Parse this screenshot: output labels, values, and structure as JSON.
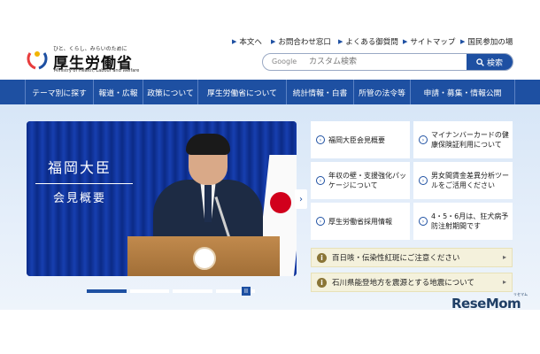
{
  "header": {
    "logo_tagline": "ひと、くらし、みらいのために",
    "logo_name": "厚生労働省",
    "logo_en": "Ministry of Health, Labour and Welfare",
    "util_links": [
      "本文へ",
      "お問合わせ窓口",
      "よくある御質問",
      "サイトマップ",
      "国民参加の場"
    ],
    "search": {
      "google_label": "Google",
      "placeholder": "カスタム検索",
      "button_label": "検索",
      "button_icon": "search-icon"
    }
  },
  "nav": {
    "items": [
      "テーマ別に探す",
      "報道・広報",
      "政策について",
      "厚生労働省について",
      "統計情報・白書",
      "所管の法令等",
      "申請・募集・情報公開"
    ]
  },
  "hero": {
    "caption_line1": "福岡大臣",
    "caption_line2": "会見概要",
    "slide_count": 6,
    "active_slide": 1,
    "pause_label": "II",
    "next_label": "›"
  },
  "cards": [
    {
      "text": "福岡大臣会見概要"
    },
    {
      "text": "マイナンバーカードの健康保険証利用について"
    },
    {
      "text": "年収の壁・支援強化パッケージについて"
    },
    {
      "text": "男女間賃金差異分析ツールをご活用ください"
    },
    {
      "text": "厚生労働省採用情報"
    },
    {
      "text": "4・5・6月は、狂犬病予防注射期間です"
    }
  ],
  "notices": [
    {
      "text": "百日咳・伝染性紅斑にご注意ください"
    },
    {
      "text": "石川県能登地方を震源とする地震について"
    }
  ],
  "watermark": {
    "text": "ReseMom",
    "sub": "リセマム"
  },
  "colors": {
    "accent": "#1e50a2",
    "background": "#d7e6f7",
    "notice_bg": "#f4f1dc"
  }
}
